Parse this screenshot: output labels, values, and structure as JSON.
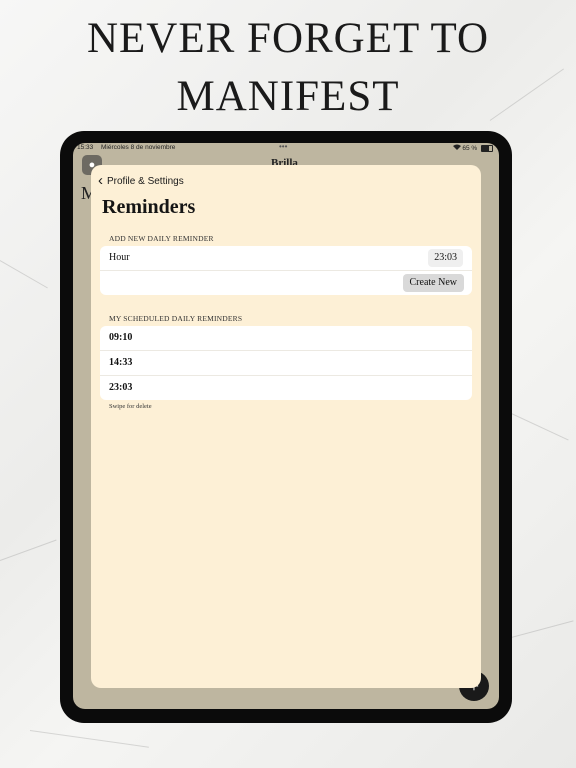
{
  "headline": {
    "line1": "NEVER FORGET TO",
    "line2": "MANIFEST"
  },
  "status_bar": {
    "time": "15:33",
    "date": "Miércoles 8 de noviembre",
    "dots": "•••",
    "battery": "65 %"
  },
  "background_app": {
    "title": "Brilla",
    "partial_heading": "M",
    "avatar_icon": "person-icon",
    "fab_icon": "plus-icon"
  },
  "sheet": {
    "back_label": "Profile & Settings",
    "title": "Reminders",
    "add_section": {
      "label": "ADD NEW DAILY REMINDER",
      "hour_label": "Hour",
      "hour_value": "23:03",
      "create_button": "Create New"
    },
    "scheduled_section": {
      "label": "MY SCHEDULED DAILY REMINDERS",
      "reminders": [
        "09:10",
        "14:33",
        "23:03"
      ],
      "hint": "Swipe for delete"
    }
  },
  "colors": {
    "sheet_bg": "#fdf0d6",
    "screen_bg": "#beb6a0",
    "device": "#0b0b0b"
  }
}
